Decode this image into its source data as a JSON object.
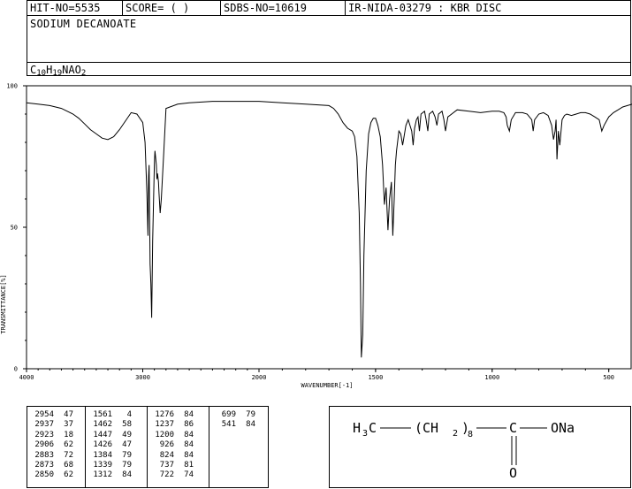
{
  "header": {
    "hit_no": "HIT-NO=5535",
    "score": "SCORE=  (   )",
    "sdbs_no": "SDBS-NO=10619",
    "ir_nida": "IR-NIDA-03279 : KBR DISC",
    "compound_name": "SODIUM DECANOATE",
    "formula": {
      "c": "C",
      "c_n": "10",
      "h": "H",
      "h_n": "19",
      "rest": "NAO",
      "o_n": "2"
    }
  },
  "chart_data": {
    "type": "line",
    "title": "",
    "xlabel": "WAVENUMBER[-1]",
    "ylabel": "TRANSMITTANCE[%]",
    "xlim": [
      4000,
      400
    ],
    "ylim": [
      0,
      100
    ],
    "x_ticks": [
      "4000",
      "3000",
      "2000",
      "1500",
      "1000",
      "500"
    ],
    "y_ticks": [
      "100",
      "50",
      "0"
    ],
    "grid": false,
    "series": [
      {
        "name": "",
        "x": [
          4000,
          3900,
          3800,
          3700,
          3600,
          3550,
          3500,
          3450,
          3400,
          3350,
          3300,
          3250,
          3200,
          3150,
          3100,
          3050,
          3000,
          2980,
          2964,
          2955,
          2950,
          2945,
          2937,
          2930,
          2923,
          2915,
          2906,
          2900,
          2895,
          2883,
          2878,
          2873,
          2865,
          2860,
          2850,
          2840,
          2820,
          2800,
          2700,
          2600,
          2400,
          2200,
          2000,
          1900,
          1800,
          1700,
          1680,
          1660,
          1640,
          1620,
          1600,
          1590,
          1580,
          1570,
          1565,
          1561,
          1555,
          1550,
          1540,
          1530,
          1520,
          1510,
          1500,
          1490,
          1480,
          1470,
          1462,
          1455,
          1447,
          1440,
          1432,
          1426,
          1420,
          1415,
          1410,
          1400,
          1392,
          1384,
          1378,
          1370,
          1360,
          1345,
          1339,
          1333,
          1325,
          1318,
          1312,
          1305,
          1290,
          1283,
          1276,
          1270,
          1255,
          1245,
          1237,
          1230,
          1215,
          1207,
          1200,
          1190,
          1150,
          1100,
          1050,
          1000,
          970,
          950,
          940,
          935,
          926,
          918,
          900,
          870,
          850,
          830,
          824,
          818,
          800,
          780,
          760,
          745,
          737,
          730,
          726,
          722,
          716,
          710,
          700,
          690,
          680,
          660,
          640,
          620,
          600,
          580,
          560,
          541,
          530,
          520,
          500,
          480,
          460,
          440,
          420,
          400
        ],
        "y": [
          94,
          93.5,
          93,
          92,
          90,
          88.5,
          86.5,
          84.5,
          83,
          81.5,
          81,
          82,
          84.5,
          87.5,
          90.5,
          90,
          87,
          80,
          62,
          47,
          68,
          72,
          37,
          30,
          18,
          45,
          62,
          73,
          77,
          72,
          67,
          69,
          66,
          62,
          55,
          60,
          76,
          92,
          93.5,
          94,
          94.5,
          94.5,
          94.5,
          94,
          93.5,
          93,
          92,
          90,
          87,
          85,
          84,
          82,
          75,
          55,
          30,
          4,
          12,
          40,
          70,
          83,
          87,
          88.5,
          88.5,
          86,
          82,
          72,
          58,
          64,
          49,
          60,
          66,
          47,
          60,
          72,
          77,
          84,
          83,
          79,
          82,
          86,
          88,
          84,
          79,
          85,
          88,
          89,
          84,
          90,
          91,
          88,
          84,
          90,
          91,
          89,
          86,
          90,
          91,
          88,
          84,
          89,
          91.5,
          91,
          90.5,
          91,
          91,
          90.5,
          89,
          86,
          84,
          88,
          90.5,
          90.5,
          90,
          88,
          84,
          88,
          90,
          90.5,
          89.5,
          86,
          81,
          84,
          88,
          74,
          84,
          79,
          88,
          89.5,
          90,
          89.5,
          90,
          90.5,
          90.5,
          90,
          89,
          88,
          84,
          86,
          89,
          90.5,
          91.5,
          92.5,
          93,
          93.5
        ]
      }
    ],
    "peak_table": [
      [
        [
          "2954",
          "47"
        ],
        [
          "2937",
          "37"
        ],
        [
          "2923",
          "18"
        ],
        [
          "2906",
          "62"
        ],
        [
          "2883",
          "72"
        ],
        [
          "2873",
          "68"
        ],
        [
          "2850",
          "62"
        ]
      ],
      [
        [
          "1561",
          "4"
        ],
        [
          "1462",
          "58"
        ],
        [
          "1447",
          "49"
        ],
        [
          "1426",
          "47"
        ],
        [
          "1384",
          "79"
        ],
        [
          "1339",
          "79"
        ],
        [
          "1312",
          "84"
        ]
      ],
      [
        [
          "1276",
          "84"
        ],
        [
          "1237",
          "86"
        ],
        [
          "1200",
          "84"
        ],
        [
          "926",
          "84"
        ],
        [
          "824",
          "84"
        ],
        [
          "737",
          "81"
        ],
        [
          "722",
          "74"
        ]
      ],
      [
        [
          "699",
          "79"
        ],
        [
          "541",
          "84"
        ]
      ]
    ]
  },
  "structure": {
    "h3c": "H",
    "h3c_sub": "3",
    "h3c_c": "C",
    "chain_open": "(CH",
    "chain_sub": "2",
    "chain_close": ")",
    "chain_n": "8",
    "carbonyl_c": "C",
    "ona": "ONa",
    "oxygen": "O"
  }
}
